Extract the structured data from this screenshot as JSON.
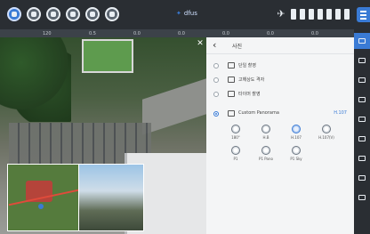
{
  "colors": {
    "accent": "#3a7bd5",
    "topbar": "#2a2e33",
    "panel": "#f4f5f6"
  },
  "topbar": {
    "brand": "dfus",
    "icons": [
      "home-icon",
      "settings-icon",
      "download-icon",
      "camera-icon",
      "gallery-icon",
      "info-icon"
    ]
  },
  "telemetry": [
    "120",
    "0.5",
    "0.0",
    "0.0",
    "0.0",
    "0.0",
    "0.0"
  ],
  "panel": {
    "title": "사진",
    "options": [
      {
        "label": "단일 촬영",
        "selected": false
      },
      {
        "label": "고해상도 격자",
        "selected": false
      },
      {
        "label": "타이머 촬영",
        "selected": false
      },
      {
        "label": "Custom Panorama",
        "value": "H.107",
        "selected": true
      }
    ],
    "panorama_modes": [
      "180°",
      "H.B",
      "H.107",
      "H.107(V)",
      "P1",
      "P1 Pano",
      "P1 Sky"
    ],
    "selected_mode": "H.107"
  },
  "rail": {
    "items": [
      "camera",
      "RTK",
      "obstacle",
      "HD",
      "display",
      "gimbal",
      "more",
      "map"
    ]
  }
}
